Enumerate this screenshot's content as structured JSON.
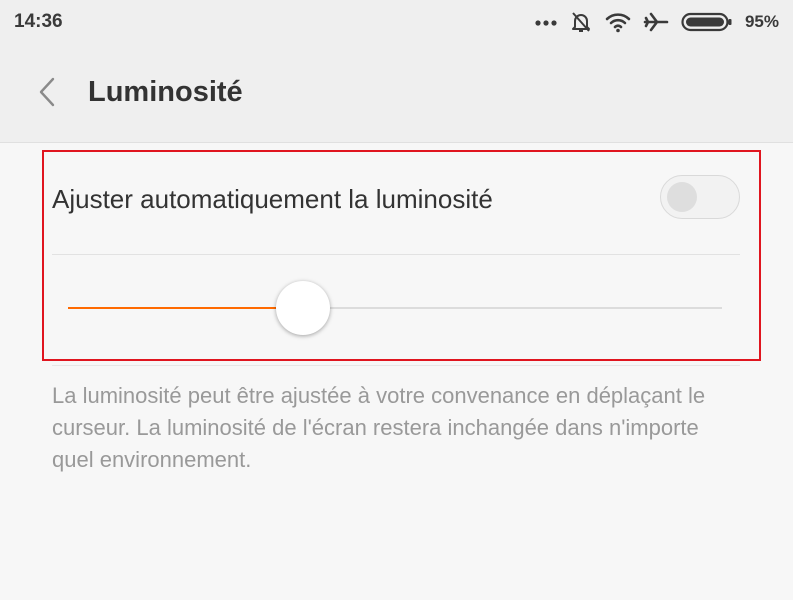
{
  "status_bar": {
    "time": "14:36",
    "battery_percent": "95%",
    "icons": [
      "more-dots-icon",
      "alarm-off-icon",
      "wifi-icon",
      "airplane-icon",
      "battery-icon"
    ]
  },
  "header": {
    "back_icon": "chevron-left-icon",
    "title": "Luminosité"
  },
  "auto_brightness": {
    "label": "Ajuster automatiquement la luminosité",
    "enabled": false
  },
  "brightness_slider": {
    "value": 0.36,
    "accent_color": "#ff6a00"
  },
  "description": "La luminosité peut être ajustée à votre convenance en déplaçant le curseur. La luminosité de l'écran restera inchangée dans n'importe quel environnement.",
  "colors": {
    "highlight_border": "#e0151f",
    "background": "#f7f7f7"
  }
}
